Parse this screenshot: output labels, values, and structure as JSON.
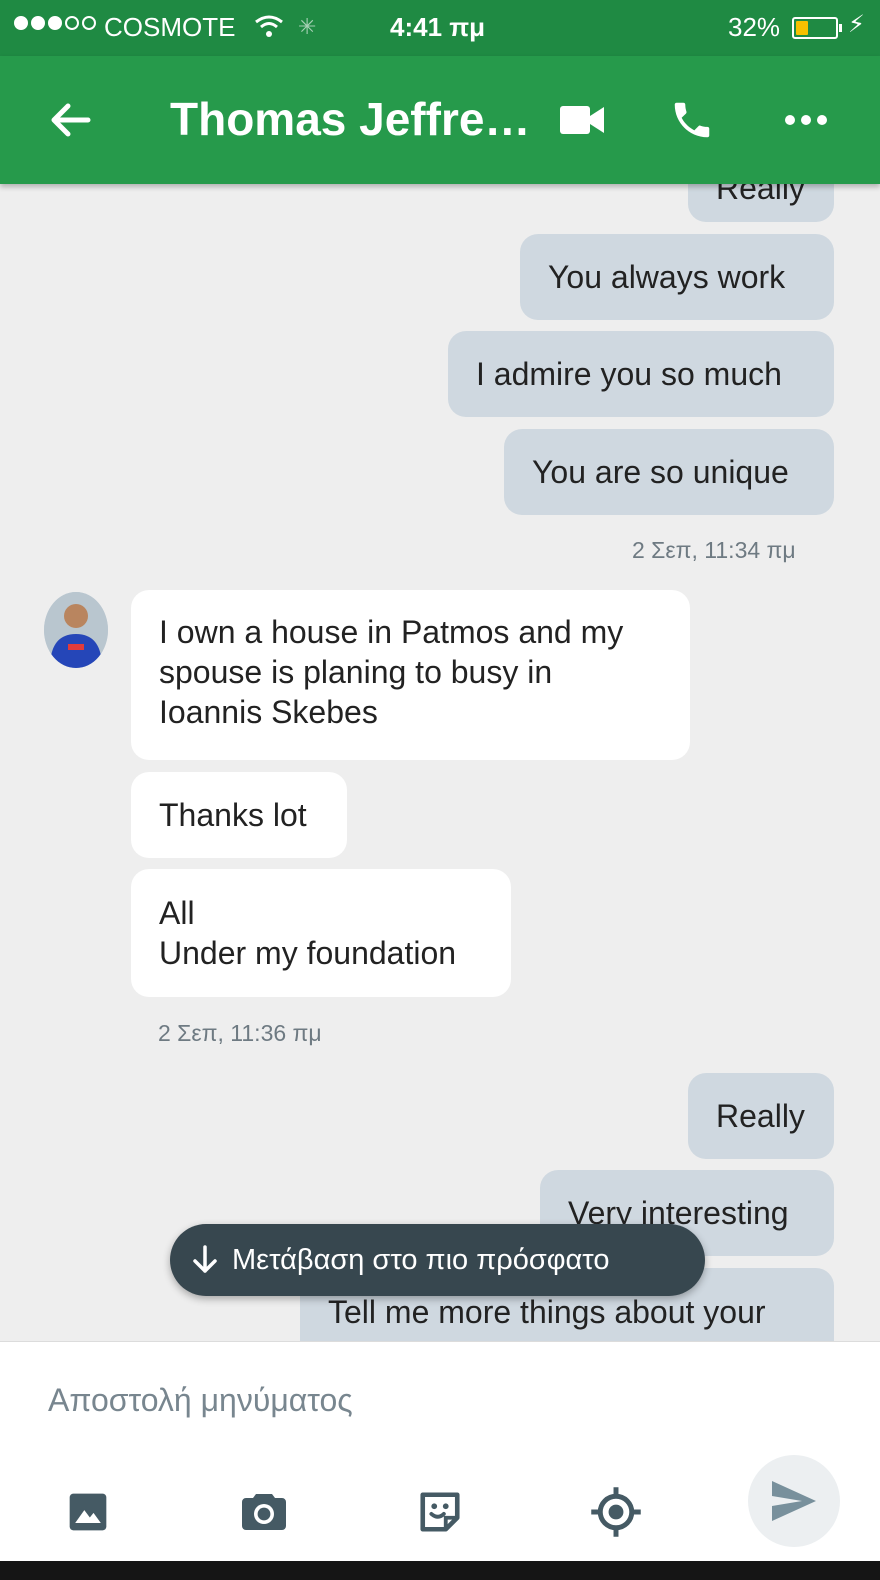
{
  "status_bar": {
    "signal_dots": [
      true,
      true,
      true,
      false,
      false
    ],
    "carrier": "COSMOTE",
    "time": "4:41 πμ",
    "battery_percent": "32%",
    "battery_level": 0.32,
    "accent": "#f5c100"
  },
  "app_bar": {
    "title": "Thomas Jeffre…",
    "color": "#269a4b",
    "icons": [
      "arrow-back-icon",
      "videocam-icon",
      "phone-icon",
      "more-horiz-icon"
    ]
  },
  "messages": {
    "partial_top": "Really",
    "out1": "You always work",
    "out2": "I admire you so much",
    "out3": "You are so unique",
    "ts1": "2 Σεπ, 11:34 πμ",
    "in1_lines": [
      "I own a house in Patmos and my",
      "spouse is planing to busy in",
      "Ioannis Skebes"
    ],
    "in2": "Thanks lot",
    "in3_lines": [
      "All",
      "Under my foundation"
    ],
    "ts2": "2 Σεπ, 11:36 πμ",
    "out4": "Really",
    "out5": "Very interesting",
    "out6_partial": "Tell me more things about your"
  },
  "jump_to_latest": {
    "label": "Μετάβαση στο πιο πρόσφατο",
    "icon": "arrow-down-icon"
  },
  "compose": {
    "placeholder": "Αποστολή μηνύματος",
    "tools": [
      "image-icon",
      "camera-icon",
      "sticker-icon",
      "location-icon"
    ],
    "send_icon": "send-icon"
  }
}
